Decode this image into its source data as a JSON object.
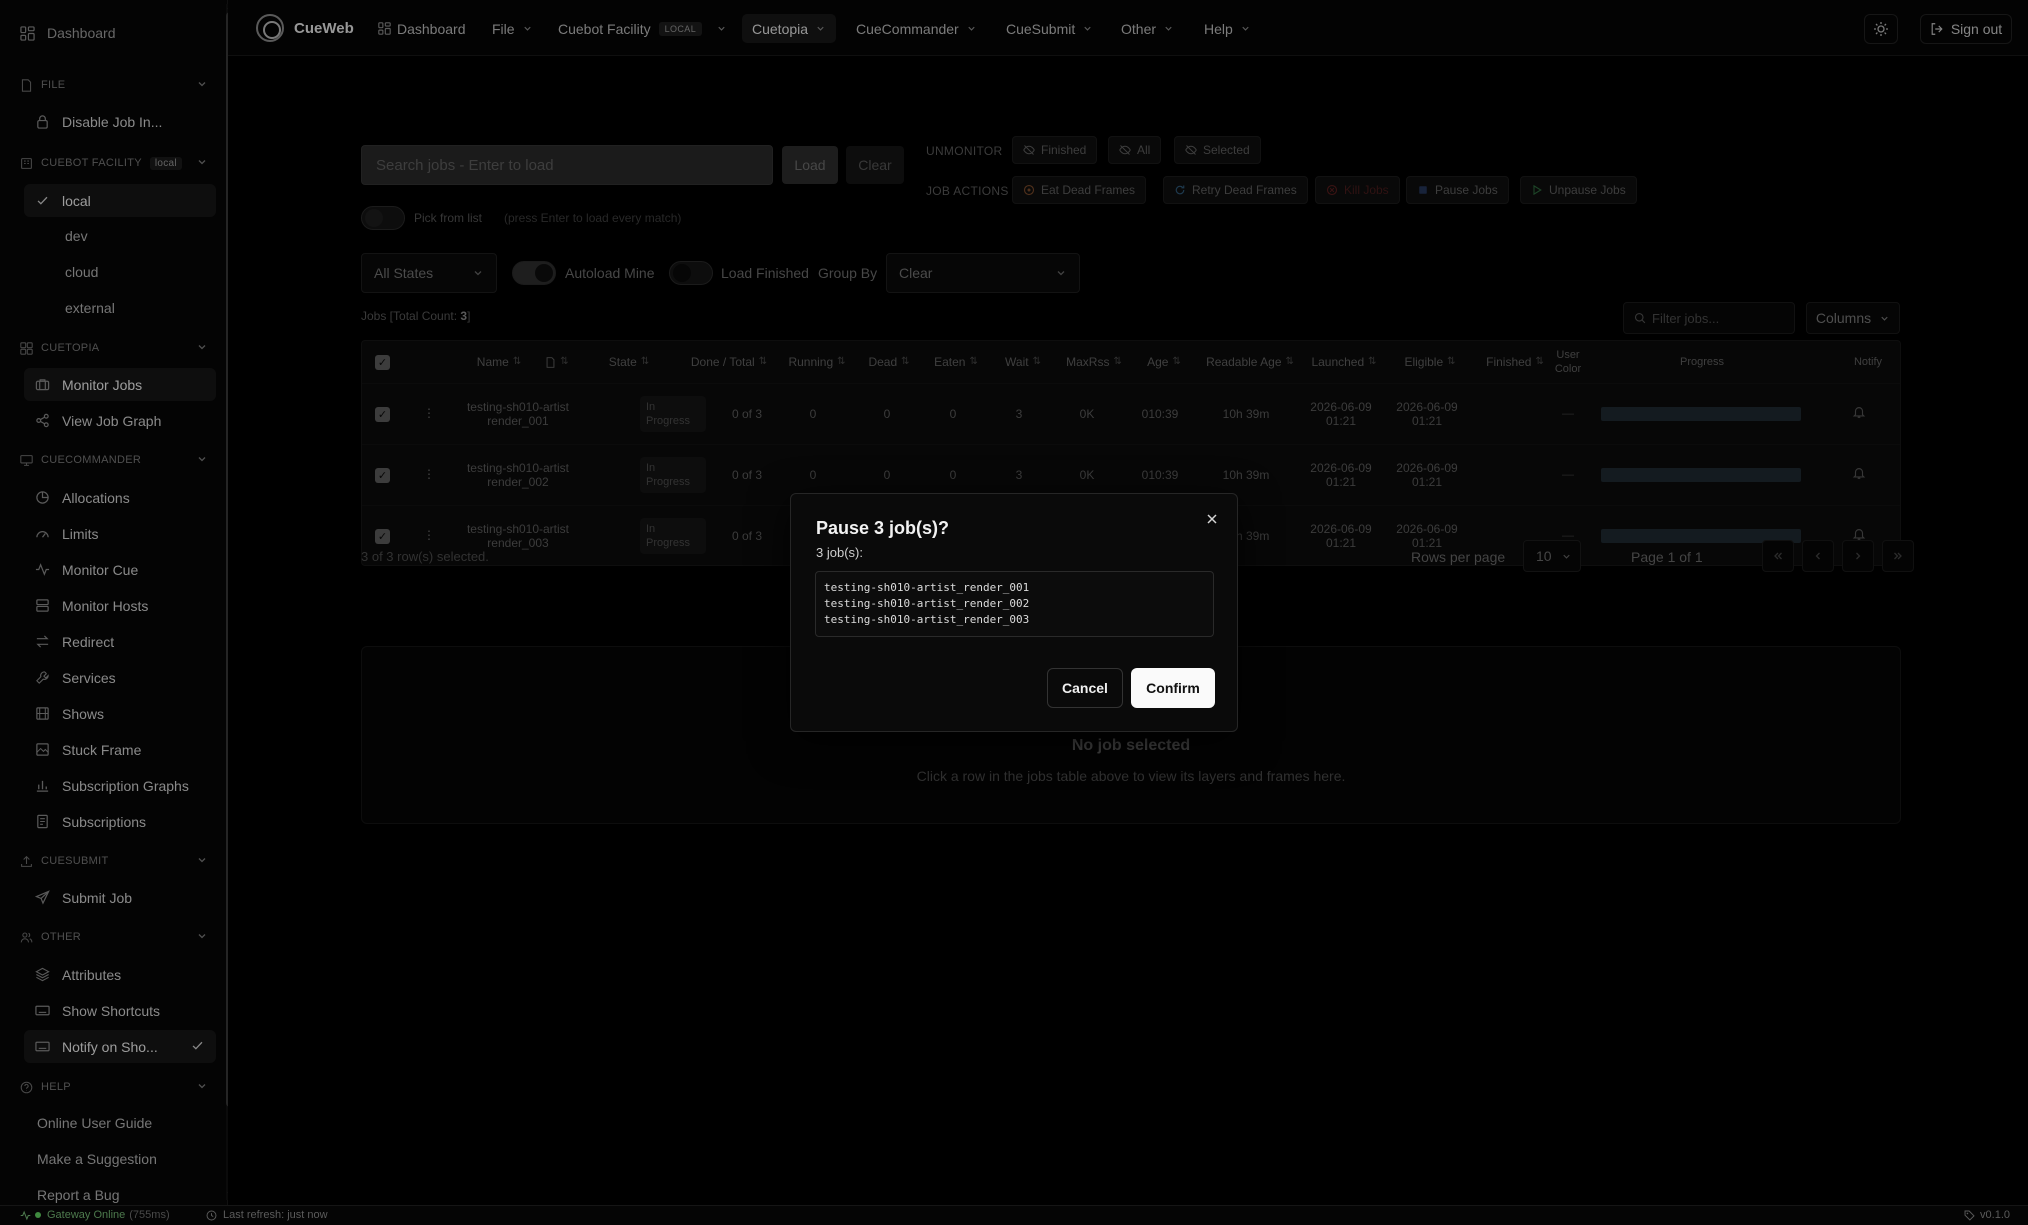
{
  "sidebar": {
    "dashboard": "Dashboard",
    "sections": [
      {
        "key": "file",
        "label": "FILE"
      },
      {
        "key": "facility",
        "label": "CUEBOT FACILITY",
        "tag": "local"
      },
      {
        "key": "cuetopia",
        "label": "CUETOPIA"
      },
      {
        "key": "cuecommander",
        "label": "CUECOMMANDER"
      },
      {
        "key": "cuesubmit",
        "label": "CUESUBMIT"
      },
      {
        "key": "other",
        "label": "OTHER"
      },
      {
        "key": "help",
        "label": "HELP"
      }
    ],
    "file_items": [
      "Disable Job In..."
    ],
    "facility_items": [
      "local",
      "dev",
      "cloud",
      "external"
    ],
    "cuetopia_items": [
      "Monitor Jobs",
      "View Job Graph"
    ],
    "cuecommander_items": [
      "Allocations",
      "Limits",
      "Monitor Cue",
      "Monitor Hosts",
      "Redirect",
      "Services",
      "Shows",
      "Stuck Frame",
      "Subscription Graphs",
      "Subscriptions"
    ],
    "cuesubmit_items": [
      "Submit Job"
    ],
    "other_items": [
      "Attributes",
      "Show Shortcuts",
      "Notify on Sho..."
    ],
    "help_items": [
      "Online User Guide",
      "Make a Suggestion",
      "Report a Bug"
    ]
  },
  "topbar": {
    "brand": "CueWeb",
    "nav": {
      "dashboard": "Dashboard",
      "file": "File",
      "facility": "Cuebot Facility",
      "facility_badge": "LOCAL",
      "cuetopia": "Cuetopia",
      "cuecommander": "CueCommander",
      "cuesubmit": "CueSubmit",
      "other": "Other",
      "help": "Help"
    },
    "signout": "Sign out"
  },
  "toolbar": {
    "search_placeholder": "Search jobs - Enter to load",
    "load": "Load",
    "clear": "Clear",
    "unmonitor_label": "UNMONITOR",
    "unmonitor_finished": "Finished",
    "unmonitor_all": "All",
    "unmonitor_selected": "Selected",
    "job_actions_label": "JOB ACTIONS",
    "eat_dead_frames": "Eat Dead Frames",
    "retry_dead_frames": "Retry Dead Frames",
    "kill_jobs": "Kill Jobs",
    "pause_jobs": "Pause Jobs",
    "unpause_jobs": "Unpause Jobs",
    "pick_from_list": "Pick from list",
    "pick_hint": "(press Enter to load every match)",
    "states_select": "All States",
    "autoload_mine": "Autoload Mine",
    "load_finished": "Load Finished",
    "group_by": "Group By",
    "group_by_value": "Clear"
  },
  "jobs": {
    "count_prefix": "Jobs [Total Count: ",
    "count": "3",
    "count_suffix": "]",
    "filter_placeholder": "Filter jobs...",
    "columns_btn": "Columns",
    "headers": {
      "name": "Name",
      "state": "State",
      "done_total": "Done / Total",
      "running": "Running",
      "dead": "Dead",
      "eaten": "Eaten",
      "wait": "Wait",
      "maxrss": "MaxRss",
      "age": "Age",
      "readable_age": "Readable Age",
      "launched": "Launched",
      "eligible": "Eligible",
      "finished": "Finished",
      "user_color": "User Color",
      "progress": "Progress",
      "notify": "Notify"
    },
    "rows": [
      {
        "name_line1": "testing-sh010-artist",
        "name_line2": "render_001",
        "state_line1": "In",
        "state_line2": "Progress",
        "done_total": "0 of 3",
        "running": "0",
        "dead": "0",
        "eaten": "0",
        "wait": "3",
        "maxrss": "0K",
        "age": "010:39",
        "readable_age": "10h 39m",
        "launched_date": "2026-06-09",
        "launched_time": "01:21",
        "eligible_date": "2026-06-09",
        "eligible_time": "01:21",
        "user_color": "—",
        "progress": 0.0
      },
      {
        "name_line1": "testing-sh010-artist",
        "name_line2": "render_002",
        "state_line1": "In",
        "state_line2": "Progress",
        "done_total": "0 of 3",
        "running": "0",
        "dead": "0",
        "eaten": "0",
        "wait": "3",
        "maxrss": "0K",
        "age": "010:39",
        "readable_age": "10h 39m",
        "launched_date": "2026-06-09",
        "launched_time": "01:21",
        "eligible_date": "2026-06-09",
        "eligible_time": "01:21",
        "user_color": "—",
        "progress": 0.0
      },
      {
        "name_line1": "testing-sh010-artist",
        "name_line2": "render_003",
        "state_line1": "In",
        "state_line2": "Progress",
        "done_total": "0 of 3",
        "running": "0",
        "dead": "0",
        "eaten": "0",
        "wait": "3",
        "maxrss": "0K",
        "age": "010:39",
        "readable_age": "10h 39m",
        "launched_date": "2026-06-09",
        "launched_time": "01:21",
        "eligible_date": "2026-06-09",
        "eligible_time": "01:21",
        "user_color": "—",
        "progress": 0.0
      }
    ],
    "selected_summary": "3 of 3 row(s) selected.",
    "rows_per_page_label": "Rows per page",
    "rows_per_page": "10",
    "page_info": "Page 1 of 1"
  },
  "detail": {
    "title": "No job selected",
    "subtitle": "Click a row in the jobs table above to view its layers and frames here."
  },
  "modal": {
    "title": "Pause 3 job(s)?",
    "subtitle": "3 job(s):",
    "jobs": [
      "testing-sh010-artist_render_001",
      "testing-sh010-artist_render_002",
      "testing-sh010-artist_render_003"
    ],
    "cancel": "Cancel",
    "confirm": "Confirm"
  },
  "status": {
    "gateway": "Gateway Online",
    "latency": "(755ms)",
    "last_refresh": "Last refresh: just now",
    "version": "v0.1.0"
  },
  "icons": {
    "dashboard": "grid-icon",
    "file": "file-icon",
    "lock": "lock-icon",
    "facility": "building-icon",
    "check": "check-icon",
    "monitor": "briefcase-icon",
    "graph": "share-icon",
    "chevron": "chevron-down-icon",
    "theme": "sun-icon",
    "signout": "logout-icon",
    "close": "close-icon",
    "bell": "bell-icon"
  },
  "colors": {
    "accent_confirm": "#fafafa",
    "gateway_online": "#3f8a3f",
    "progress_track": "#1f2a32"
  }
}
